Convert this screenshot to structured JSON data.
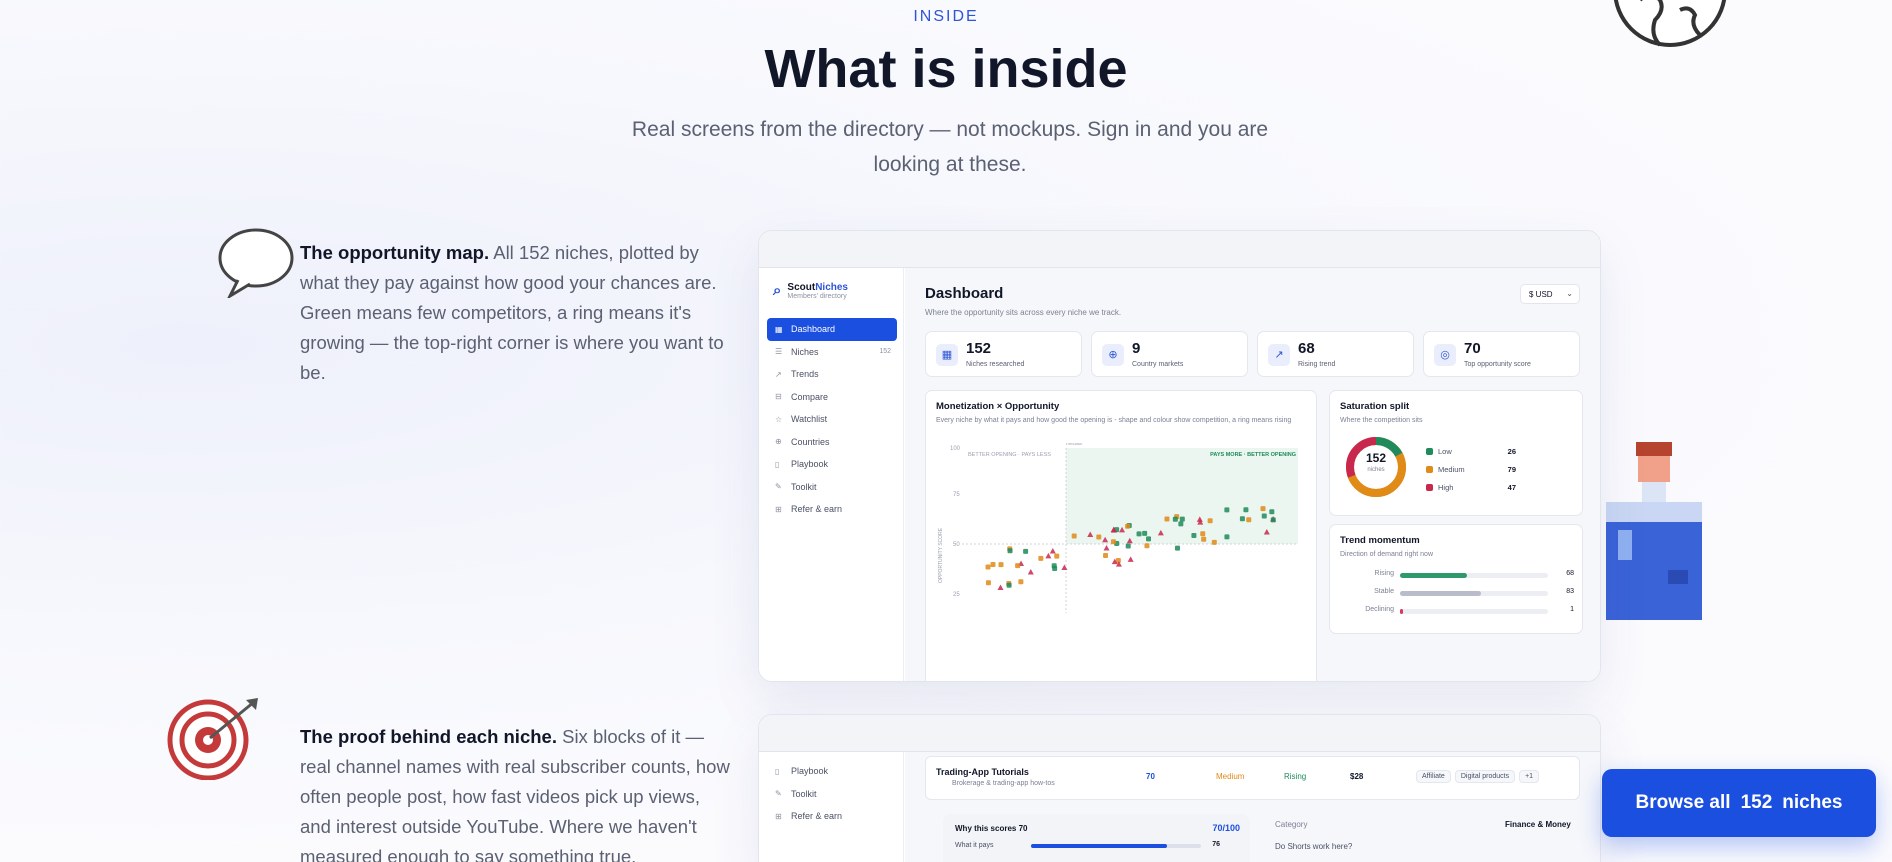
{
  "header": {
    "eyebrow": "INSIDE",
    "title": "What is inside",
    "subtitle": "Real screens from the directory — not mockups. Sign in and you are looking at these."
  },
  "features": [
    {
      "lead": "The opportunity map.",
      "body": " All 152 niches, plotted by what they pay against how good your chances are. Green means few competitors, a ring means it's growing — the top-right corner is where you want to be."
    },
    {
      "lead": "The proof behind each niche.",
      "body": " Six blocks of it — real channel names with real subscriber counts, how often people post, how fast videos pick up views, and interest outside YouTube. Where we haven't measured enough to say something true."
    }
  ],
  "dashboard": {
    "brand_a": "Scout",
    "brand_b": "Niches",
    "brand_tag": "Members' directory",
    "nav": [
      {
        "icon": "▦",
        "label": "Dashboard",
        "count": ""
      },
      {
        "icon": "☰",
        "label": "Niches",
        "count": "152"
      },
      {
        "icon": "↗",
        "label": "Trends",
        "count": ""
      },
      {
        "icon": "⊟",
        "label": "Compare",
        "count": ""
      },
      {
        "icon": "☆",
        "label": "Watchlist",
        "count": ""
      },
      {
        "icon": "⊕",
        "label": "Countries",
        "count": ""
      },
      {
        "icon": "▯",
        "label": "Playbook",
        "count": ""
      },
      {
        "icon": "✎",
        "label": "Toolkit",
        "count": ""
      },
      {
        "icon": "⊞",
        "label": "Refer & earn",
        "count": ""
      }
    ],
    "title": "Dashboard",
    "subtitle": "Where the opportunity sits across every niche we track.",
    "currency": "$ USD",
    "stats": [
      {
        "icon": "▦",
        "value": "152",
        "label": "Niches researched"
      },
      {
        "icon": "⊕",
        "value": "9",
        "label": "Country markets"
      },
      {
        "icon": "↗",
        "value": "68",
        "label": "Rising trend"
      },
      {
        "icon": "◎",
        "value": "70",
        "label": "Top opportunity score"
      }
    ],
    "scatter": {
      "title": "Monetization × Opportunity",
      "subtitle": "Every niche by what it pays and how good the opening is - shape and colour show competition, a ring means rising",
      "quad_left": "BETTER OPENING · PAYS LESS",
      "quad_right": "PAYS MORE · BETTER OPENING",
      "median": "median",
      "ylabel": "OPPORTUNITY SCORE",
      "y_ticks": [
        "100",
        "75",
        "50",
        "25"
      ]
    },
    "saturation": {
      "title": "Saturation split",
      "subtitle": "Where the competition sits",
      "total": "152",
      "total_label": "niches",
      "items": [
        {
          "label": "Low",
          "value": "26",
          "color": "#1f8a5b"
        },
        {
          "label": "Medium",
          "value": "79",
          "color": "#e08a17"
        },
        {
          "label": "High",
          "value": "47",
          "color": "#c8284d"
        }
      ]
    },
    "momentum": {
      "title": "Trend momentum",
      "subtitle": "Direction of demand right now",
      "items": [
        {
          "label": "Rising",
          "value": "68",
          "fraction": 0.45,
          "color": "#2e9a6a"
        },
        {
          "label": "Stable",
          "value": "83",
          "fraction": 0.55,
          "color": "#b9bccb"
        },
        {
          "label": "Declining",
          "value": "1",
          "fraction": 0.02,
          "color": "#d93a5a"
        }
      ]
    }
  },
  "detail": {
    "nav": [
      {
        "icon": "▯",
        "label": "Playbook"
      },
      {
        "icon": "✎",
        "label": "Toolkit"
      },
      {
        "icon": "⊞",
        "label": "Refer & earn"
      }
    ],
    "niche_title": "Trading-App Tutorials",
    "niche_sub": "Brokerage & trading-app how-tos",
    "score": "70",
    "saturation": "Medium",
    "trend": "Rising",
    "rpm": "$28",
    "tags": [
      "Affiliate",
      "Digital products",
      "+1"
    ],
    "why_title": "Why this scores 70",
    "why_score": "70/100",
    "why_row": "What it pays",
    "why_value": "76",
    "category_label": "Category",
    "category_value": "Finance & Money",
    "question": "Do Shorts work here?"
  },
  "cta": {
    "lead": "Browse all",
    "count": "152",
    "tail": "niches"
  },
  "colors": {
    "accent": "#1b4fe0",
    "low": "#1f8a5b",
    "medium": "#e08a17",
    "high": "#c8284d"
  }
}
